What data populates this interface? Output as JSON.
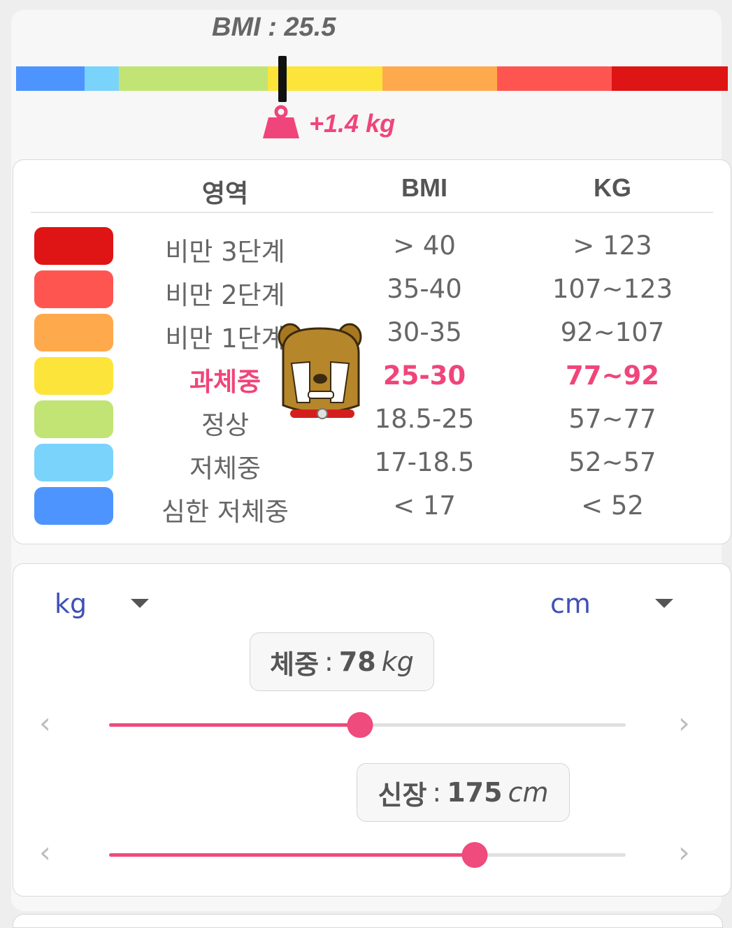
{
  "bmi": {
    "label": "BMI : 25.5"
  },
  "scale_colors": [
    "#4d94ff",
    "#7ad3fb",
    "#c1e474",
    "#fde43a",
    "#ffa94d",
    "#ff5551",
    "#df1414"
  ],
  "difference": {
    "text": "+1.4 kg",
    "icon": "weight-icon"
  },
  "table": {
    "headers": {
      "zone": "영역",
      "bmi": "BMI",
      "kg": "KG"
    },
    "rows": [
      {
        "zone": "비만 3단계",
        "bmi": "> 40",
        "kg": "> 123",
        "color": "#df1414"
      },
      {
        "zone": "비만 2단계",
        "bmi": "35-40",
        "kg": "107~123",
        "color": "#ff5551"
      },
      {
        "zone": "비만 1단계",
        "bmi": "30-35",
        "kg": "92~107",
        "color": "#ffa94d"
      },
      {
        "zone": "과체중",
        "bmi": "25-30",
        "kg": "77~92",
        "color": "#fde43a",
        "active": true
      },
      {
        "zone": "정상",
        "bmi": "18.5-25",
        "kg": "57~77",
        "color": "#c1e474"
      },
      {
        "zone": "저체중",
        "bmi": "17-18.5",
        "kg": "52~57",
        "color": "#7ad3fb"
      },
      {
        "zone": "심한 저체중",
        "bmi": "< 17",
        "kg": "< 52",
        "color": "#4d94ff"
      }
    ]
  },
  "units": {
    "weight": "kg",
    "height": "cm"
  },
  "weight": {
    "label": "체중",
    "separator": ":",
    "value": "78",
    "unit": "kg",
    "slider_fraction": 0.486
  },
  "height": {
    "label": "신장",
    "separator": ":",
    "value": "175",
    "unit": "cm",
    "slider_fraction": 0.708
  },
  "accent_color": "#ef4b7d"
}
